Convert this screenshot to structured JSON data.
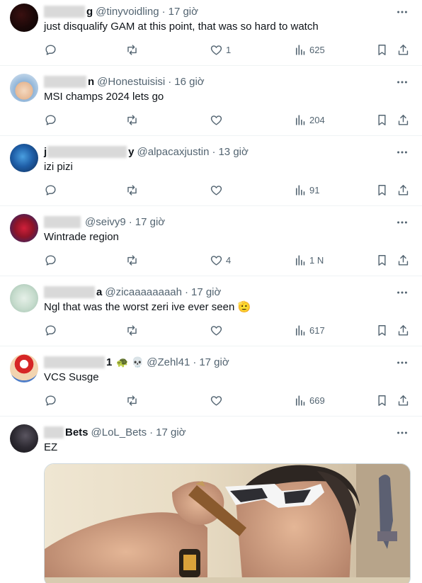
{
  "tweets": [
    {
      "name_tail": "g",
      "handle": "@tinyvoidling",
      "time": "17 giờ",
      "text": "just disqualify GAM at this point, that was so hard to watch",
      "likes": "1",
      "views": "625"
    },
    {
      "name_tail": "n",
      "handle": "@Honestuisisi",
      "time": "16 giờ",
      "text": "MSI champs 2024 lets go",
      "likes": "",
      "views": "204"
    },
    {
      "name_head": "j",
      "name_tail": "y",
      "handle": "@alpacaxjustin",
      "time": "13 giờ",
      "text": "izi pizi",
      "likes": "",
      "views": "91"
    },
    {
      "name_tail": "",
      "handle": "@seivy9",
      "time": "17 giờ",
      "text": "Wintrade region",
      "likes": "4",
      "views": "1 N"
    },
    {
      "name_tail": "a",
      "handle": "@zicaaaaaaaah",
      "time": "17 giờ",
      "text": "Ngl that was the worst zeri ive ever seen",
      "text_emoji": "🫡",
      "likes": "",
      "views": "617"
    },
    {
      "name_tail": "1",
      "name_emojis": [
        "🐢",
        "💀"
      ],
      "handle": "@Zehl41",
      "time": "17 giờ",
      "text": "VCS Susge",
      "likes": "",
      "views": "669"
    },
    {
      "name_tail": "Bets",
      "handle": "@LoL_Bets",
      "time": "17 giờ",
      "text": "EZ"
    }
  ],
  "separator": "·",
  "colors": {
    "text": "#0f1419",
    "secondary": "#536471",
    "divider": "#eff3f4"
  }
}
